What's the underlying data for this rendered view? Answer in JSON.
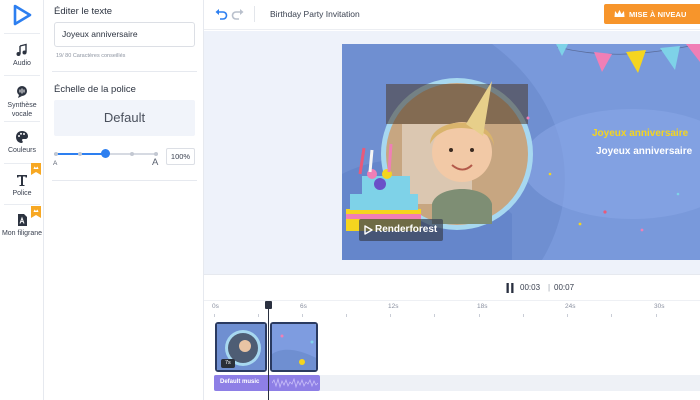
{
  "rail": {
    "items": [
      {
        "label": "Audio",
        "icon": "music-note-icon"
      },
      {
        "label": "Synthèse vocale",
        "icon": "voice-synthesis-icon"
      },
      {
        "label": "Couleurs",
        "icon": "palette-icon"
      },
      {
        "label": "Police",
        "icon": "font-icon"
      },
      {
        "label": "Mon filigrane",
        "icon": "watermark-icon"
      }
    ],
    "accent": "#2d7ff0",
    "badge_color": "#f7a823"
  },
  "panel": {
    "edit_heading": "Éditer le texte",
    "text_value": "Joyeux anniversaire",
    "char_hint": "19/ 80 Caractères conseillés",
    "scale_heading": "Échelle de la police",
    "font_preview": "Default",
    "small_a": "A",
    "big_a": "A",
    "scale_percent": "100%",
    "scale_level": 0.5
  },
  "topbar": {
    "project_title": "Birthday Party Invitation",
    "upgrade_label": "MISE À NIVEAU",
    "upgrade_color": "#f7952b"
  },
  "scene": {
    "title_yellow": "Joyeux anniversaire",
    "title_white": "Joyeux anniversaire",
    "watermark": "Renderforest",
    "background": "#6f8fd1",
    "yellow": "#f5d51f"
  },
  "playback": {
    "current_time": "00:03",
    "separator": "|",
    "total_time": "00:07"
  },
  "timeline": {
    "ruler": [
      "0s",
      "6s",
      "12s",
      "18s",
      "24s",
      "30s"
    ],
    "clip_badge": "7s",
    "music_label": "Default music"
  }
}
